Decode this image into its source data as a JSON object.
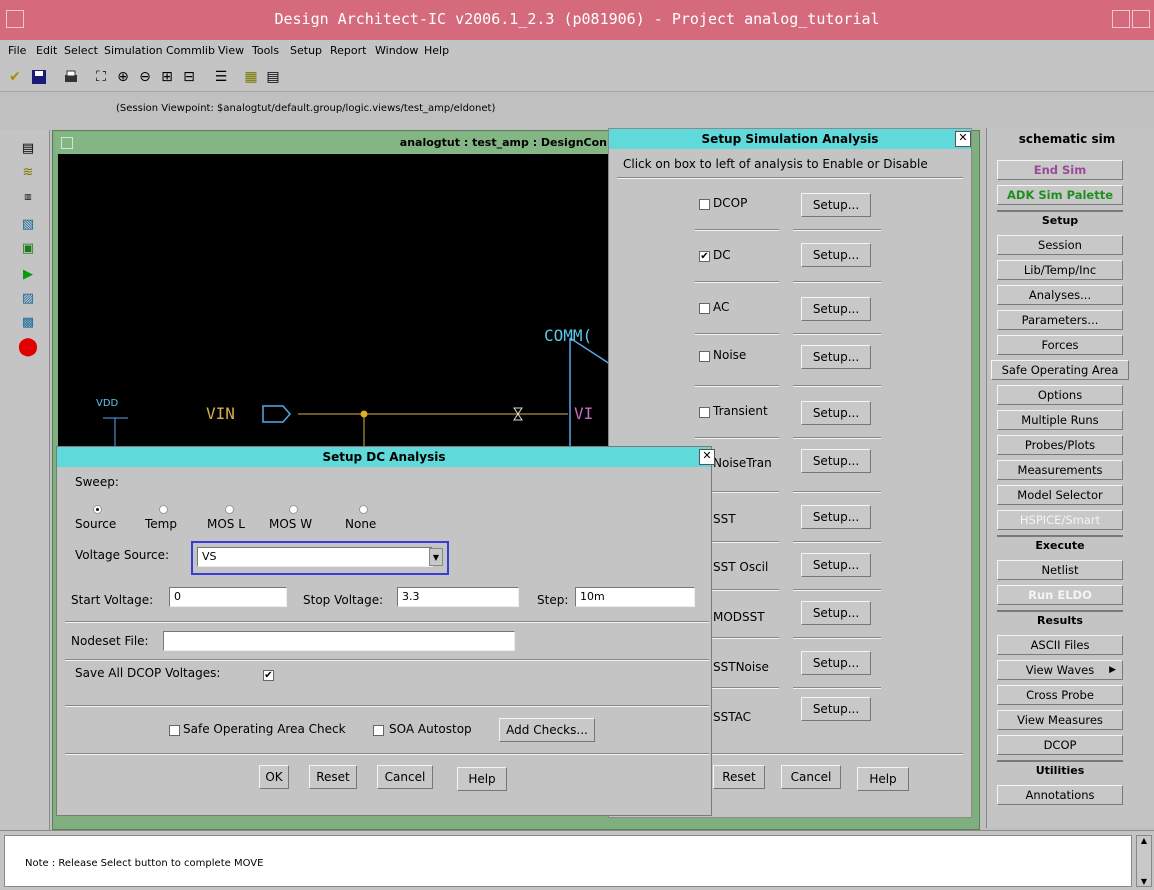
{
  "window": {
    "title": "Design Architect-IC v2006.1_2.3   (p081906)  - Project analog_tutorial"
  },
  "menu": [
    "File",
    "Edit",
    "Select",
    "Simulation",
    "Commlib",
    "View",
    "Tools",
    "Setup",
    "Report",
    "Window",
    "Help"
  ],
  "viewpoint": "(Session Viewpoint: $analogtut/default.group/logic.views/test_amp/eldonet)",
  "schematic": {
    "title": "analogtut : test_amp : DesignCon",
    "labels": {
      "comm": "COMM(",
      "vdd": "VDD",
      "vin": "VIN",
      "vin2": "VI"
    }
  },
  "ssa": {
    "title": "Setup Simulation Analysis",
    "instruction": "Click on box to left of analysis to Enable or Disable",
    "setup_label": "Setup...",
    "analyses": [
      {
        "label": "DCOP",
        "checked": false
      },
      {
        "label": "DC",
        "checked": true
      },
      {
        "label": "AC",
        "checked": false
      },
      {
        "label": "Noise",
        "checked": false
      },
      {
        "label": "Transient",
        "checked": false
      },
      {
        "label": "NoiseTran",
        "checked": false
      },
      {
        "label": "SST",
        "checked": false
      },
      {
        "label": "SST Oscil",
        "checked": false
      },
      {
        "label": "MODSST",
        "checked": false
      },
      {
        "label": "SSTNoise",
        "checked": false
      },
      {
        "label": "SSTAC",
        "checked": false
      }
    ],
    "reset": "Reset",
    "cancel": "Cancel",
    "help": "Help",
    "check_glyph": "✔"
  },
  "dc": {
    "title": "Setup DC Analysis",
    "sweep_label": "Sweep:",
    "sweep_options": [
      "Source",
      "Temp",
      "MOS L",
      "MOS W",
      "None"
    ],
    "sweep_selected": "Source",
    "voltage_source_label": "Voltage Source:",
    "voltage_source_value": "VS",
    "start_label": "Start Voltage:",
    "start_value": "0",
    "stop_label": "Stop Voltage:",
    "stop_value": "3.3",
    "step_label": "Step:",
    "step_value": "10m",
    "nodeset_label": "Nodeset File:",
    "nodeset_value": "",
    "save_dcop_label": "Save All DCOP Voltages:",
    "save_dcop_checked": true,
    "soa_check_label": "Safe Operating Area Check",
    "soa_autostop_label": "SOA Autostop",
    "add_checks_label": "Add Checks...",
    "ok": "OK",
    "reset": "Reset",
    "cancel": "Cancel",
    "help": "Help"
  },
  "palette": {
    "title": "schematic sim",
    "end_sim": "End Sim",
    "adk": "ADK Sim Palette",
    "setup_header": "Setup",
    "setup_items": [
      "Session",
      "Lib/Temp/Inc",
      "Analyses...",
      "Parameters...",
      "Forces",
      "Safe Operating Area",
      "Options",
      "Multiple Runs",
      "Probes/Plots",
      "Measurements",
      "Model Selector",
      "HSPICE/Smart"
    ],
    "execute_header": "Execute",
    "execute_items": [
      "Netlist",
      "Run ELDO"
    ],
    "results_header": "Results",
    "results_items": [
      "ASCII Files",
      "View Waves",
      "Cross Probe",
      "View Measures",
      "DCOP"
    ],
    "utilities_header": "Utilities",
    "utilities_items": [
      "Annotations"
    ],
    "colors": {
      "end_sim": "#9b4a9b",
      "adk": "#1f8f1f",
      "disabled": "#f4f4f4"
    }
  },
  "status": "Note : Release Select button to complete MOVE"
}
